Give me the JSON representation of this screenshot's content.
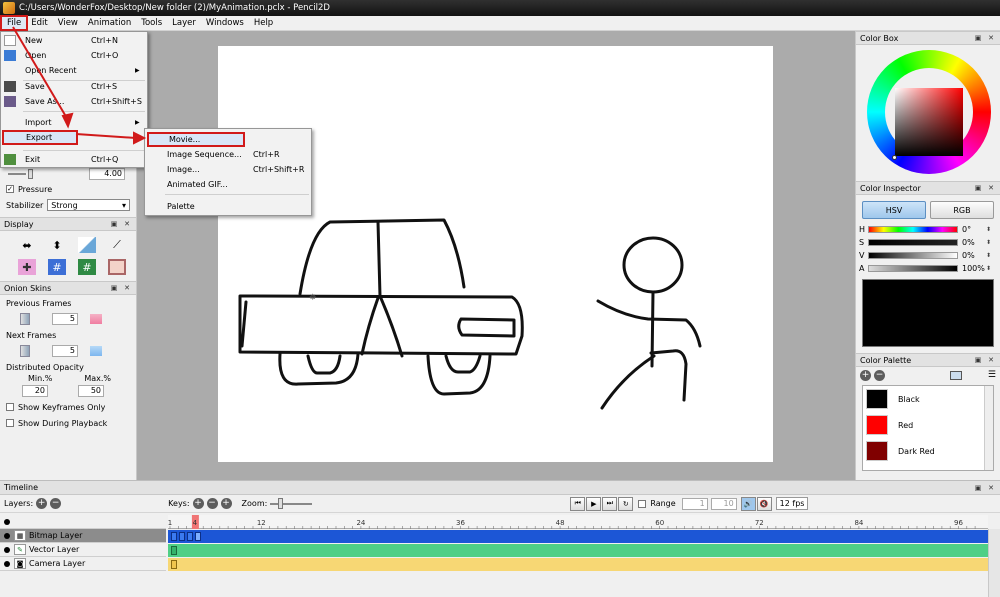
{
  "window": {
    "title": "C:/Users/WonderFox/Desktop/New folder (2)/MyAnimation.pclx - Pencil2D"
  },
  "menubar": [
    "File",
    "Edit",
    "View",
    "Animation",
    "Tools",
    "Layer",
    "Windows",
    "Help"
  ],
  "file_menu": {
    "items": [
      {
        "label": "New",
        "shortcut": "Ctrl+N",
        "icon": "new-file-icon"
      },
      {
        "label": "Open",
        "shortcut": "Ctrl+O",
        "icon": "open-folder-icon"
      },
      {
        "label": "Open Recent",
        "shortcut": "",
        "submenu": true
      },
      {
        "label": "Save",
        "shortcut": "Ctrl+S",
        "icon": "save-icon"
      },
      {
        "label": "Save As...",
        "shortcut": "Ctrl+Shift+S",
        "icon": "save-as-icon"
      },
      {
        "label": "Import",
        "shortcut": "",
        "submenu": true
      },
      {
        "label": "Export",
        "shortcut": "",
        "submenu": true
      },
      {
        "label": "Exit",
        "shortcut": "Ctrl+Q",
        "icon": "exit-icon"
      }
    ]
  },
  "export_menu": {
    "items": [
      {
        "label": "Movie...",
        "shortcut": ""
      },
      {
        "label": "Image Sequence...",
        "shortcut": "Ctrl+R"
      },
      {
        "label": "Image...",
        "shortcut": "Ctrl+Shift+R"
      },
      {
        "label": "Animated GIF...",
        "shortcut": ""
      },
      {
        "label": "Palette",
        "shortcut": ""
      }
    ]
  },
  "tool_options": {
    "size_value": "4.00",
    "pressure_label": "Pressure",
    "pressure_checked": true,
    "stabilizer_label": "Stabilizer",
    "stabilizer_value": "Strong"
  },
  "display_panel": {
    "title": "Display"
  },
  "onion_skins": {
    "title": "Onion Skins",
    "previous_label": "Previous Frames",
    "previous_value": "5",
    "next_label": "Next Frames",
    "next_value": "5",
    "opacity_label": "Distributed Opacity",
    "min_label": "Min.%",
    "max_label": "Max.%",
    "min_value": "20",
    "max_value": "50",
    "keyframes_only_label": "Show Keyframes Only",
    "during_playback_label": "Show During Playback"
  },
  "color_box": {
    "title": "Color Box"
  },
  "color_inspector": {
    "title": "Color Inspector",
    "hsv_label": "HSV",
    "rgb_label": "RGB",
    "channels": [
      {
        "label": "H",
        "value": "0°"
      },
      {
        "label": "S",
        "value": "0%"
      },
      {
        "label": "V",
        "value": "0%"
      },
      {
        "label": "A",
        "value": "100%"
      }
    ],
    "current_color": "#000000"
  },
  "color_palette": {
    "title": "Color Palette",
    "colors": [
      {
        "name": "Black",
        "hex": "#000000"
      },
      {
        "name": "Red",
        "hex": "#ff0000"
      },
      {
        "name": "Dark Red",
        "hex": "#800000"
      }
    ]
  },
  "timeline": {
    "title": "Timeline",
    "layers_label": "Layers:",
    "keys_label": "Keys:",
    "zoom_label": "Zoom:",
    "range_label": "Range",
    "range_start": "1",
    "range_end": "10",
    "fps_value": "12 fps",
    "ruler_labels": [
      "1",
      "4",
      "12",
      "24",
      "36",
      "48",
      "60",
      "72",
      "84",
      "96"
    ],
    "current_frame": 4,
    "layers": [
      {
        "name": "Bitmap Layer",
        "color": "#1c56d6"
      },
      {
        "name": "Vector Layer",
        "color": "#4fcf86"
      },
      {
        "name": "Camera Layer",
        "color": "#f7d774"
      }
    ]
  }
}
